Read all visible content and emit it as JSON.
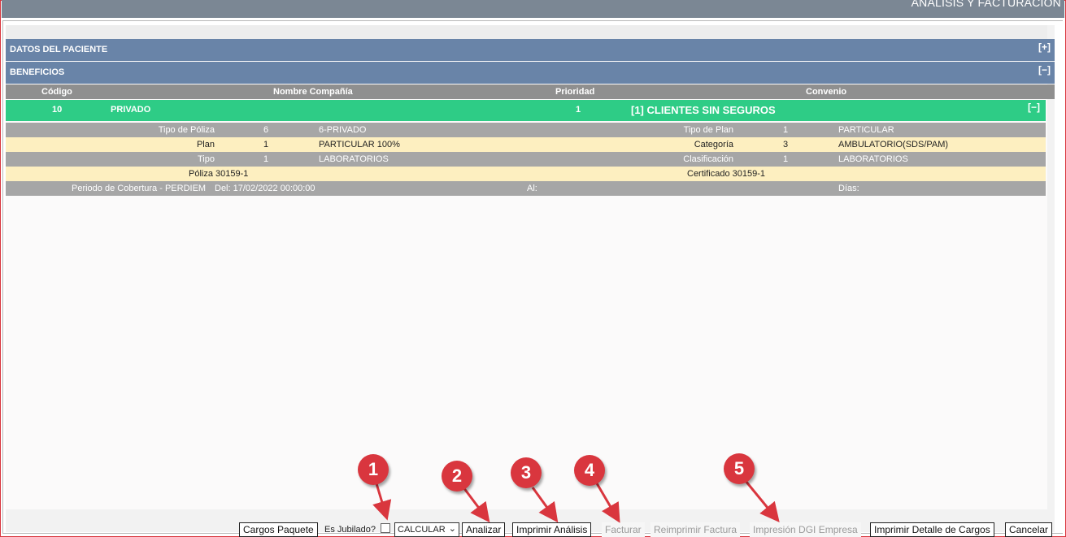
{
  "window": {
    "title": "ANÁLISIS Y FACTURACIÓN"
  },
  "sections": {
    "patient": {
      "label": "DATOS DEL PACIENTE",
      "toggle": "[+]"
    },
    "benefits": {
      "label": "BENEFICIOS",
      "toggle": "[−]"
    }
  },
  "table_header": {
    "codigo": "Código",
    "nombre": "Nombre Compañía",
    "prioridad": "Prioridad",
    "convenio": "Convenio"
  },
  "company_row": {
    "codigo": "10",
    "nombre": "PRIVADO",
    "prioridad": "1",
    "convenio": "[1] CLIENTES SIN SEGUROS",
    "toggle": "[−]"
  },
  "details": {
    "tipo_poliza": {
      "label": "Tipo de Póliza",
      "code": "6",
      "value": "6-PRIVADO"
    },
    "tipo_plan": {
      "label": "Tipo de Plan",
      "code": "1",
      "value": "PARTICULAR"
    },
    "plan": {
      "label": "Plan",
      "code": "1",
      "value": "PARTICULAR 100%"
    },
    "categoria": {
      "label": "Categoría",
      "code": "3",
      "value": "AMBULATORIO(SDS/PAM)"
    },
    "tipo": {
      "label": "Tipo",
      "code": "1",
      "value": "LABORATORIOS"
    },
    "clasificacion": {
      "label": "Clasificación",
      "code": "1",
      "value": "LABORATORIOS"
    },
    "poliza": "Póliza 30159-1",
    "certificado": "Certificado 30159-1",
    "periodo_label": "Periodo de Cobertura - PERDIEM",
    "del": "Del: 17/02/2022 00:00:00",
    "al": "Al:",
    "dias": "Días:"
  },
  "footer": {
    "cargos_paquete": "Cargos Paquete",
    "es_jubilado": "Es Jubilado?",
    "es_jubilado_checked": false,
    "calcular_select": "CALCULAR",
    "analizar": "Analizar",
    "imprimir_analisis": "Imprimir Análisis",
    "facturar": "Facturar",
    "reimprimir_factura": "Reimprimir Factura",
    "impresion_dgi": "Impresión DGI Empresa",
    "imprimir_detalle": "Imprimir Detalle de Cargos",
    "cancelar": "Cancelar"
  },
  "annotations": [
    "1",
    "2",
    "3",
    "4",
    "5"
  ],
  "colors": {
    "accent_red": "#d9363e",
    "section_blue": "#6984a8",
    "green": "#2ecc86",
    "cream": "#fdefc0",
    "gray": "#a6a6a6"
  }
}
